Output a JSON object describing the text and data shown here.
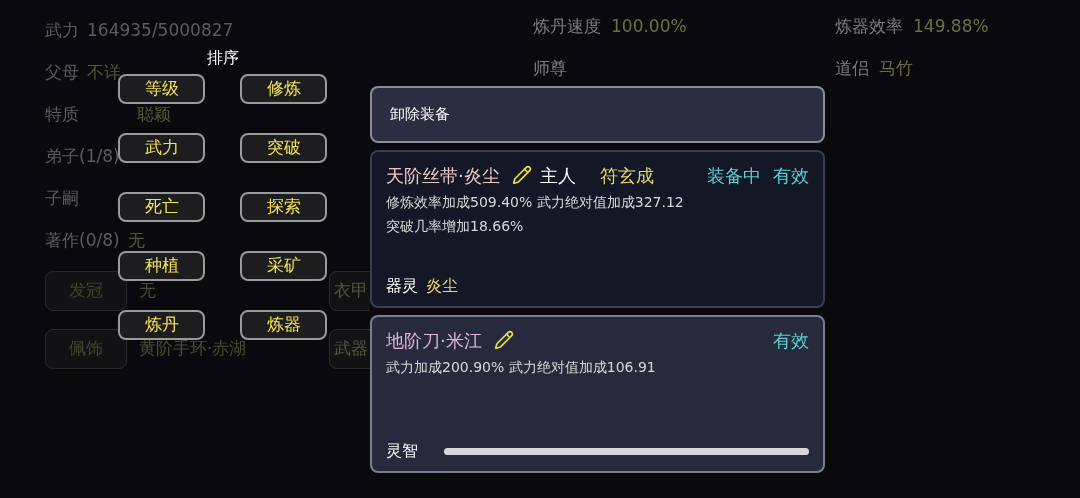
{
  "profile": {
    "rows": [
      {
        "label": "武力",
        "value": "164935/5000827"
      },
      {
        "label": "父母",
        "value": "不详"
      },
      {
        "label": "特质",
        "value": "聪颖"
      },
      {
        "label": "弟子(1/8)"
      },
      {
        "label": "子嗣"
      },
      {
        "label": "著作(0/8)",
        "value": "无"
      }
    ],
    "slots": [
      {
        "slot": "发冠",
        "item": "无",
        "slot_2": "衣甲"
      },
      {
        "slot": "佩饰",
        "item": "黄阶手环·赤湖",
        "slot_2": "武器"
      }
    ],
    "stats": [
      {
        "label": "炼丹速度",
        "value": "100.00%"
      },
      {
        "label": "师尊"
      }
    ],
    "stats_2": [
      {
        "label": "炼器效率",
        "value": "149.88%"
      },
      {
        "label": "道侣",
        "value": "马竹"
      }
    ]
  },
  "sort_popup": {
    "title": "排序",
    "options": [
      "等级",
      "修炼",
      "武力",
      "突破",
      "死亡",
      "探索",
      "种植",
      "采矿",
      "炼丹",
      "炼器"
    ]
  },
  "equipment_panel": {
    "unequip": "卸除装备",
    "items": [
      {
        "name": "天阶丝带·炎尘",
        "kind": "ribbon",
        "selected": false,
        "owner_label": "主人",
        "owner": "符玄成",
        "equipped": "装备中",
        "status": "有效",
        "effects": [
          "修炼效率加成509.40% 武力绝对值加成327.12",
          "突破几率增加18.66%"
        ],
        "spirit_label": "器灵",
        "spirit": "炎尘"
      },
      {
        "name": "地阶刀·米江",
        "kind": "blade",
        "selected": true,
        "status": "有效",
        "effects": [
          "武力加成200.90% 武力绝对值加成106.91"
        ],
        "wisdom_label": "灵智",
        "level": 1
      }
    ]
  }
}
